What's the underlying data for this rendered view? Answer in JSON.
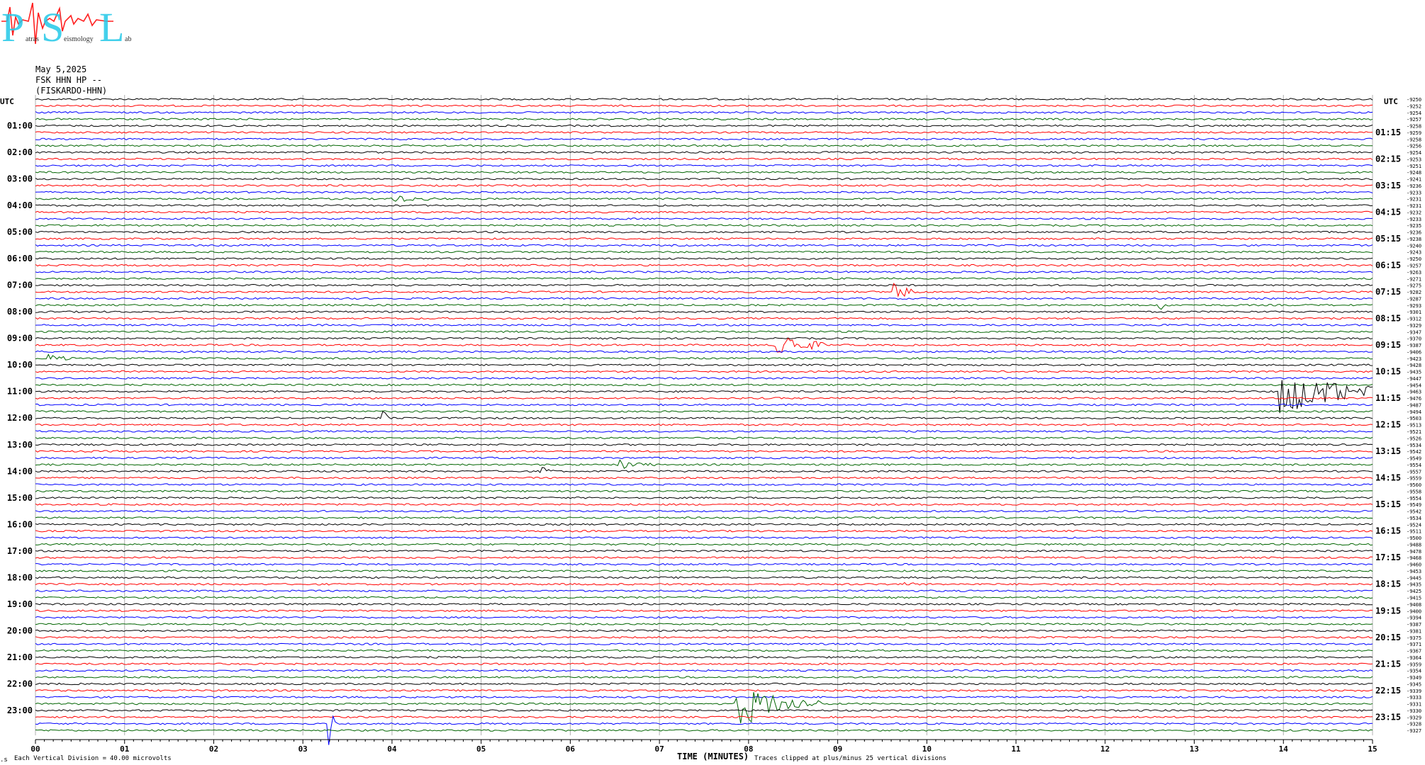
{
  "logo": {
    "letters": [
      "P",
      "S",
      "L"
    ],
    "lowercase": [
      "atras",
      "eismology",
      "ab"
    ],
    "colors": {
      "letters": "#22c8e8",
      "trace": "#ff2020"
    }
  },
  "header": {
    "date": "May 5,2025",
    "station": "FSK HHN HP --",
    "station_name": "(FISKARDO-HHN)"
  },
  "utc_label_left": "UTC",
  "utc_label_right": "UTC",
  "footer": {
    "left_mark": ".s",
    "vertical_division": "Each Vertical Division =",
    "vertical_value": "40.00 microvolts",
    "xlabel": "TIME (MINUTES)",
    "clipped_note": "Traces clipped at plus/minus 25 vertical divisions"
  },
  "colors": {
    "cycle": [
      "#000000",
      "#ff0000",
      "#0000ff",
      "#006400"
    ],
    "grid": "#b0b0b0"
  },
  "chart_data": {
    "type": "line",
    "title": "",
    "xlabel": "TIME (MINUTES)",
    "xlim": [
      0,
      15
    ],
    "x_ticks": [
      "00",
      "01",
      "02",
      "03",
      "04",
      "05",
      "06",
      "07",
      "08",
      "09",
      "10",
      "11",
      "12",
      "13",
      "14",
      "15"
    ],
    "grid": "vertical",
    "rows_per_hour": 4,
    "row_count": 96,
    "left_hour_labels": [
      "01:00",
      "02:00",
      "03:00",
      "04:00",
      "05:00",
      "06:00",
      "07:00",
      "08:00",
      "09:00",
      "10:00",
      "11:00",
      "12:00",
      "13:00",
      "14:00",
      "15:00",
      "16:00",
      "17:00",
      "18:00",
      "19:00",
      "20:00",
      "21:00",
      "22:00",
      "23:00"
    ],
    "right_hour_labels": [
      "01:15",
      "02:15",
      "03:15",
      "04:15",
      "05:15",
      "06:15",
      "07:15",
      "08:15",
      "09:15",
      "10:15",
      "11:15",
      "12:15",
      "13:15",
      "14:15",
      "15:15",
      "16:15",
      "17:15",
      "18:15",
      "19:15",
      "20:15",
      "21:15",
      "22:15",
      "23:15"
    ],
    "right_row_values": [
      "-9250",
      "-9252",
      "-9254",
      "-9257",
      "-9258",
      "-9259",
      "-9258",
      "-9256",
      "-9254",
      "-9253",
      "-9251",
      "-9248",
      "-9241",
      "-9236",
      "-9233",
      "-9231",
      "-9231",
      "-9232",
      "-9233",
      "-9235",
      "-9236",
      "-9238",
      "-9240",
      "-9243",
      "-9250",
      "-9257",
      "-9263",
      "-9271",
      "-9275",
      "-9282",
      "-9287",
      "-9293",
      "-9301",
      "-9312",
      "-9329",
      "-9347",
      "-9370",
      "-9387",
      "-9406",
      "-9423",
      "-9428",
      "-9435",
      "-9447",
      "-9454",
      "-9463",
      "-9476",
      "-9487",
      "-9494",
      "-9503",
      "-9513",
      "-9521",
      "-9526",
      "-9534",
      "-9542",
      "-9549",
      "-9554",
      "-9557",
      "-9559",
      "-9560",
      "-9558",
      "-9554",
      "-9549",
      "-9542",
      "-9534",
      "-9524",
      "-9511",
      "-9500",
      "-9488",
      "-9478",
      "-9468",
      "-9460",
      "-9453",
      "-9445",
      "-9435",
      "-9425",
      "-9415",
      "-9408",
      "-9400",
      "-9394",
      "-9387",
      "-9381",
      "-9375",
      "-9371",
      "-9367",
      "-9364",
      "-9359",
      "-9354",
      "-9349",
      "-9345",
      "-9339",
      "-9333",
      "-9331",
      "-9330",
      "-9329",
      "-9328",
      "-9327"
    ],
    "events": [
      {
        "row": 15,
        "minute": 4.0,
        "amp": 0.5,
        "dur": 0.25
      },
      {
        "row": 29,
        "minute": 9.62,
        "amp": 1.3,
        "dur": 0.15
      },
      {
        "row": 31,
        "minute": 12.58,
        "amp": 0.8,
        "dur": 0.08
      },
      {
        "row": 37,
        "minute": 8.3,
        "amp": 1.6,
        "dur": 0.35
      },
      {
        "row": 39,
        "minute": 0.15,
        "amp": 0.6,
        "dur": 0.12
      },
      {
        "row": 44,
        "minute": 13.96,
        "amp": 2.8,
        "dur": 0.6
      },
      {
        "row": 48,
        "minute": 3.9,
        "amp": 0.7,
        "dur": 0.1
      },
      {
        "row": 50,
        "minute": 0.15,
        "amp": 0.5,
        "dur": 0.08
      },
      {
        "row": 55,
        "minute": 6.5,
        "amp": 0.6,
        "dur": 0.25
      },
      {
        "row": 56,
        "minute": 5.65,
        "amp": 0.8,
        "dur": 0.08
      },
      {
        "row": 73,
        "minute": 9.7,
        "amp": 0.4,
        "dur": 0.1
      },
      {
        "row": 91,
        "minute": 7.85,
        "amp": 2.8,
        "dur": 0.45
      },
      {
        "row": 94,
        "minute": 3.3,
        "amp": 4.0,
        "dur": 0.03
      }
    ]
  }
}
